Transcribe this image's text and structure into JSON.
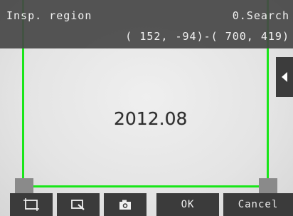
{
  "header": {
    "title": "Insp. region",
    "mode": "0.Search",
    "coordinates": "( 152, -94)-( 700, 419)"
  },
  "image": {
    "imprint_text": "2012.08"
  },
  "roi": {
    "color": "#19e619"
  },
  "side_panel": {
    "toggle_icon": "triangle-left"
  },
  "toolbar": {
    "rect_icon": "rectangle-frame",
    "zoom_icon": "zoom-area",
    "camera_icon": "camera",
    "ok_label": "OK",
    "cancel_label": "Cancel"
  }
}
